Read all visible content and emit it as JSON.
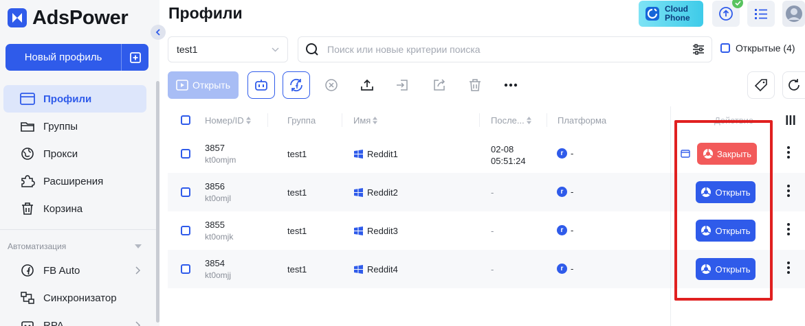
{
  "app": {
    "name": "AdsPower"
  },
  "sidebar": {
    "new_profile_label": "Новый профиль",
    "nav": [
      {
        "label": "Профили",
        "icon": "profiles-icon",
        "active": true
      },
      {
        "label": "Группы",
        "icon": "folder-icon"
      },
      {
        "label": "Прокси",
        "icon": "globe-icon"
      },
      {
        "label": "Расширения",
        "icon": "puzzle-icon"
      },
      {
        "label": "Корзина",
        "icon": "trash-icon"
      }
    ],
    "automation_title": "Автоматизация",
    "automation": [
      {
        "label": "FB Auto",
        "icon": "facebook-icon"
      },
      {
        "label": "Синхронизатор",
        "icon": "sync-icon"
      },
      {
        "label": "RPA",
        "icon": "rpa-icon"
      }
    ]
  },
  "header": {
    "title": "Профили",
    "cloud_phone_line1": "Cloud",
    "cloud_phone_line2": "Phone"
  },
  "filters": {
    "group_value": "test1",
    "search_placeholder": "Поиск или новые критерии поиска",
    "open_filter_label": "Открытые (4)"
  },
  "toolbar": {
    "open_label": "Открыть"
  },
  "table": {
    "columns": {
      "id": "Номер/ID",
      "group": "Группа",
      "name": "Имя",
      "last": "После...",
      "platform": "Платформа",
      "actions": "Действие"
    },
    "rows": [
      {
        "num": "3857",
        "sub": "kt0omjm",
        "group": "test1",
        "name": "Reddit1",
        "last_date": "02-08",
        "last_time": "05:51:24",
        "platform_letter": "r",
        "platform_value": "-",
        "action": "Закрыть",
        "state": "open"
      },
      {
        "num": "3856",
        "sub": "kt0omjl",
        "group": "test1",
        "name": "Reddit2",
        "last_date": "-",
        "last_time": "",
        "platform_letter": "r",
        "platform_value": "-",
        "action": "Открыть",
        "state": "closed"
      },
      {
        "num": "3855",
        "sub": "kt0omjk",
        "group": "test1",
        "name": "Reddit3",
        "last_date": "-",
        "last_time": "",
        "platform_letter": "r",
        "platform_value": "-",
        "action": "Открыть",
        "state": "closed"
      },
      {
        "num": "3854",
        "sub": "kt0omjj",
        "group": "test1",
        "name": "Reddit4",
        "last_date": "-",
        "last_time": "",
        "platform_letter": "r",
        "platform_value": "-",
        "action": "Открыть",
        "state": "closed"
      }
    ]
  },
  "colors": {
    "accent": "#2f5bea",
    "close": "#f25a5a",
    "highlight": "#e02020"
  }
}
